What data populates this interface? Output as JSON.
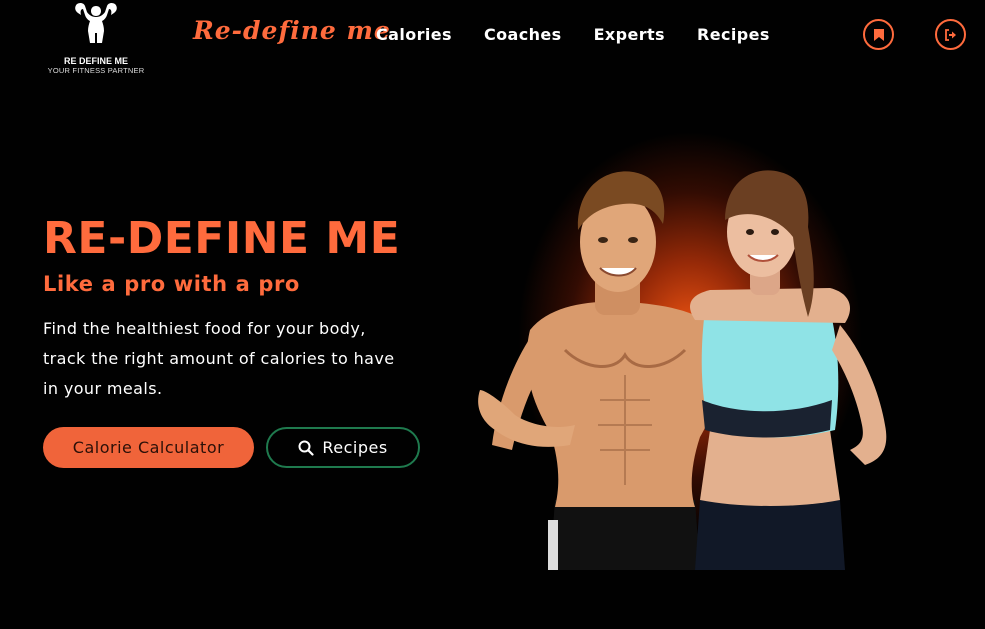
{
  "header": {
    "logo": {
      "title": "RE DEFINE ME",
      "tagline": "YOUR FITNESS PARTNER",
      "icon": "bodybuilder-icon"
    },
    "brand_name": "Re-define me",
    "nav": [
      {
        "label": "Calories"
      },
      {
        "label": "Coaches"
      },
      {
        "label": "Experts"
      },
      {
        "label": "Recipes"
      }
    ],
    "actions": [
      {
        "icon": "bookmark-icon"
      },
      {
        "icon": "logout-icon"
      }
    ]
  },
  "hero": {
    "title": "RE-DEFINE ME",
    "subtitle": "Like a pro with a pro",
    "description": "Find the healthiest food for your body, track the right amount of calories to have in your meals.",
    "primary_button": "Calorie Calculator",
    "secondary_button": {
      "label": "Recipes",
      "icon": "search-icon"
    },
    "image": "fitness-couple-image"
  },
  "colors": {
    "accent": "#ff6b3d",
    "background": "#010101",
    "secondary_border": "#1f7a4e",
    "glow": "#ff5a14"
  }
}
